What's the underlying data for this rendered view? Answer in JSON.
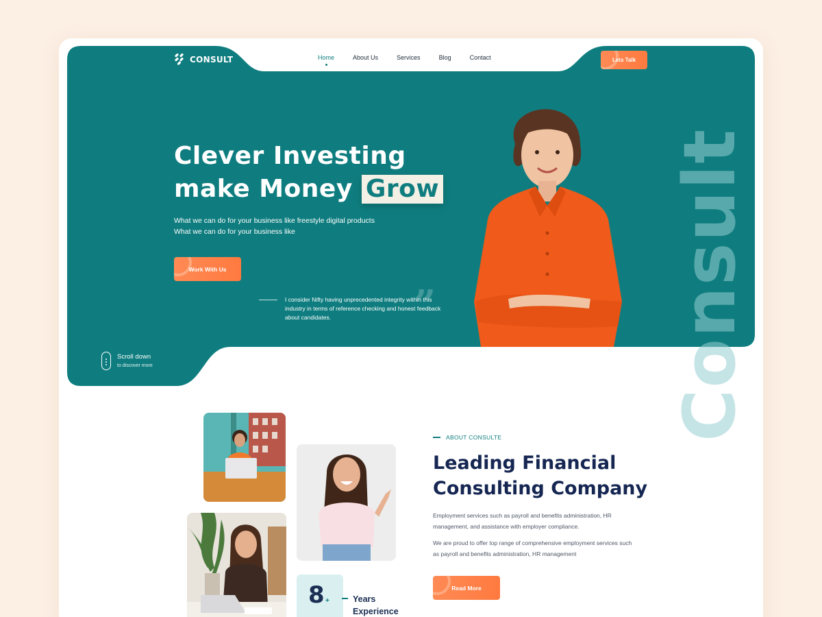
{
  "brand": {
    "name": "CONSULT"
  },
  "nav": {
    "items": [
      {
        "label": "Home",
        "active": true
      },
      {
        "label": "About Us",
        "active": false
      },
      {
        "label": "Services",
        "active": false
      },
      {
        "label": "Blog",
        "active": false
      },
      {
        "label": "Contact",
        "active": false
      }
    ],
    "cta_label": "Lets Talk"
  },
  "hero": {
    "title_line1": "Clever Investing",
    "title_line2_prefix": "make Money",
    "title_highlight": "Grow",
    "subtitle": "What we can do for your business like freestyle digital products What we can do for your business like",
    "cta_label": "Work With Us",
    "quote": "I consider Nifty having unprecedented integrity within this industry in terms of reference checking and honest feedback about candidates.",
    "quote_mark": "”",
    "vertical_word": "Consult"
  },
  "scroll": {
    "title": "Scroll down",
    "subtitle": "to discover more"
  },
  "about": {
    "eyebrow": "ABOUT CONSULTE",
    "title_line1": "Leading Financial",
    "title_line2": "Consulting Company",
    "paragraph1": "Employment services such as payroll and benefits administration, HR management, and assistance with employer compliance.",
    "paragraph2": "We are proud to offer top range of comprehensive employment services such as payroll and benefits administration, HR management",
    "cta_label": "Read More",
    "stat_number": "8",
    "stat_suffix": "+",
    "stat_label_line1": "Years",
    "stat_label_line2": "Experience"
  },
  "colors": {
    "teal": "#0f7d7f",
    "orange": "#ff7a3f",
    "navy": "#152652",
    "page_bg": "#fcefe4",
    "light_teal": "#d9eff0"
  }
}
